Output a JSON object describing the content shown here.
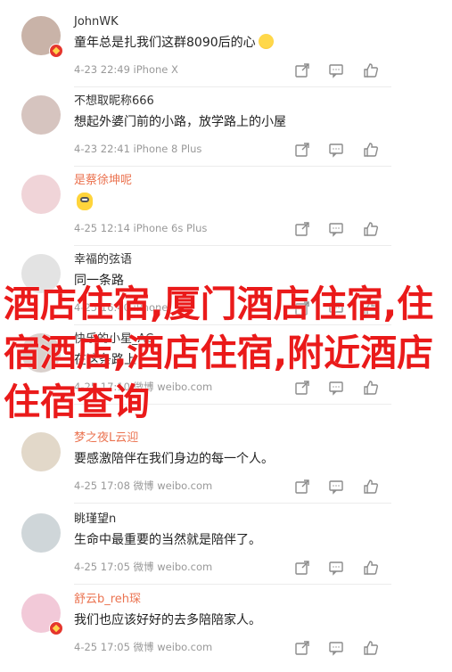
{
  "comments": [
    {
      "name": "JohnWK",
      "name_style": "reg",
      "text": "童年总是扎我们这群8090后的心",
      "emoji": "laugh",
      "meta": "4-23 22:49 iPhone X",
      "verified": true
    },
    {
      "name": "不想取昵称666",
      "name_style": "reg",
      "text": "想起外婆门前的小路，放学路上的小屋",
      "emoji": "",
      "meta": "4-23 22:41 iPhone 8 Plus",
      "verified": false
    },
    {
      "name": "是蔡徐坤呢",
      "name_style": "vip",
      "text": "",
      "emoji": "minion",
      "meta": "4-25 12:14 iPhone 6s Plus",
      "verified": false
    },
    {
      "name": "幸福的弦语",
      "name_style": "reg",
      "text": "同一条路",
      "emoji": "",
      "meta": "4-25 16:40 iPhone",
      "verified": false
    },
    {
      "name": "快乐的小星_AC",
      "name_style": "reg",
      "text": "在这条路上",
      "emoji": "",
      "meta": "4-25 17:10 微博 weibo.com",
      "verified": false
    },
    {
      "name": "梦之夜L云迎",
      "name_style": "vip",
      "text": "要感激陪伴在我们身边的每一个人。",
      "emoji": "",
      "meta": "4-25 17:08 微博 weibo.com",
      "verified": false
    },
    {
      "name": "眺瑾望n",
      "name_style": "reg",
      "text": "生命中最重要的当然就是陪伴了。",
      "emoji": "",
      "meta": "4-25 17:05 微博 weibo.com",
      "verified": false
    },
    {
      "name": "舒云b_reh琛",
      "name_style": "vip",
      "text": "我们也应该好好的去多陪陪家人。",
      "emoji": "",
      "meta": "4-25 17:05 微博 weibo.com",
      "verified": true
    }
  ],
  "overlay_text": "酒店住宿,厦门酒店住宿,住宿酒店,酒店住宿,附近酒店住宿查询",
  "colors": {
    "vip_name": "#eb7350",
    "overlay": "#ea1a1a",
    "meta": "#999999"
  },
  "icons": [
    "share-icon",
    "comment-icon",
    "like-icon"
  ]
}
